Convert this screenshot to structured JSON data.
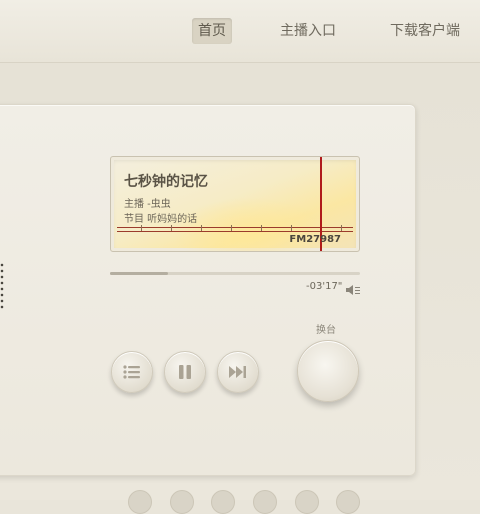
{
  "nav": {
    "items": [
      {
        "label": "首页",
        "active": true
      },
      {
        "label": "主播入口",
        "active": false
      },
      {
        "label": "下载客户端",
        "active": false
      }
    ]
  },
  "player": {
    "song_title": "七秒钟的记忆",
    "host": "主播  -虫虫",
    "program": "节目 听妈妈的话",
    "frequency": "FM27987",
    "time_remaining": "-03'17\"",
    "progress": 0.23,
    "switch_label": "换台"
  },
  "controls": {
    "icons": [
      "playlist-icon",
      "pause-icon",
      "next-icon"
    ]
  },
  "colors": {
    "needle": "#b01b1b",
    "background": "#e9e5da"
  }
}
